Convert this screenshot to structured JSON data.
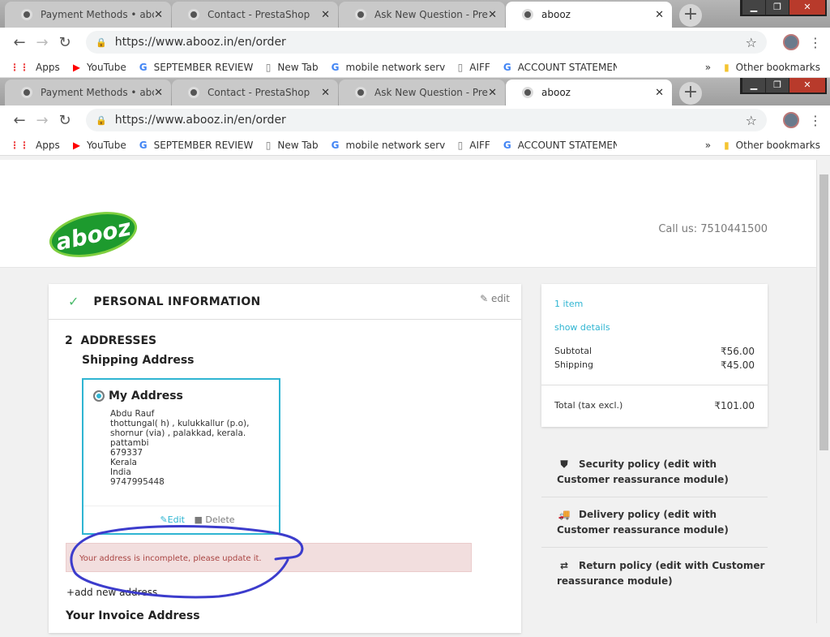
{
  "browser": {
    "tabs": [
      {
        "title": "Payment Methods • abooz",
        "active": false
      },
      {
        "title": "Contact - PrestaShop",
        "active": false
      },
      {
        "title": "Ask New Question - PrestaShop",
        "active": false
      },
      {
        "title": "abooz",
        "active": true
      }
    ],
    "url": "https://www.abooz.in/en/order",
    "bookmarks": [
      {
        "label": "Apps",
        "icon": "apps-grid-icon"
      },
      {
        "label": "YouTube",
        "icon": "youtube-icon"
      },
      {
        "label": "SEPTEMBER REVIEW T",
        "icon": "google-icon"
      },
      {
        "label": "New Tab",
        "icon": "page-icon"
      },
      {
        "label": "mobile network servic",
        "icon": "google-icon"
      },
      {
        "label": "AIFF",
        "icon": "page-icon"
      },
      {
        "label": "ACCOUNT STATEMEN",
        "icon": "google-icon"
      }
    ],
    "overflow": "»",
    "other_bookmarks": "Other bookmarks"
  },
  "header": {
    "logo_text": "abooz",
    "call_us": "Call us: 7510441500"
  },
  "checkout": {
    "personal": {
      "title": "PERSONAL INFORMATION",
      "edit": "edit"
    },
    "addresses": {
      "step": "2",
      "title": "ADDRESSES",
      "shipping_title": "Shipping Address",
      "address": {
        "alias": "My Address",
        "lines": [
          "Abdu Rauf",
          "thottungal( h) , kulukkallur (p.o),",
          "shornur (via) , palakkad, kerala.",
          "pattambi",
          "679337",
          "Kerala",
          "India",
          "9747995448"
        ],
        "edit": "Edit",
        "delete": "Delete"
      },
      "error": "Your address is incomplete, please update it.",
      "add_new": "add new address",
      "invoice_title": "Your Invoice Address"
    }
  },
  "summary": {
    "items": "1 item",
    "show_details": "show details",
    "subtotal_label": "Subtotal",
    "subtotal": "₹56.00",
    "shipping_label": "Shipping",
    "shipping": "₹45.00",
    "total_label": "Total (tax excl.)",
    "total": "₹101.00"
  },
  "reassurance": [
    {
      "icon": "shield-icon",
      "text": "Security policy (edit with Customer reassurance module)"
    },
    {
      "icon": "truck-icon",
      "text": "Delivery policy (edit with Customer reassurance module)"
    },
    {
      "icon": "arrows-exchange-icon",
      "text": "Return policy (edit with Customer reassurance module)"
    }
  ],
  "colors": {
    "accent": "#2fb5d2",
    "error_bg": "#f2dede",
    "error_text": "#a94442",
    "annotation": "#3c3ccc"
  }
}
